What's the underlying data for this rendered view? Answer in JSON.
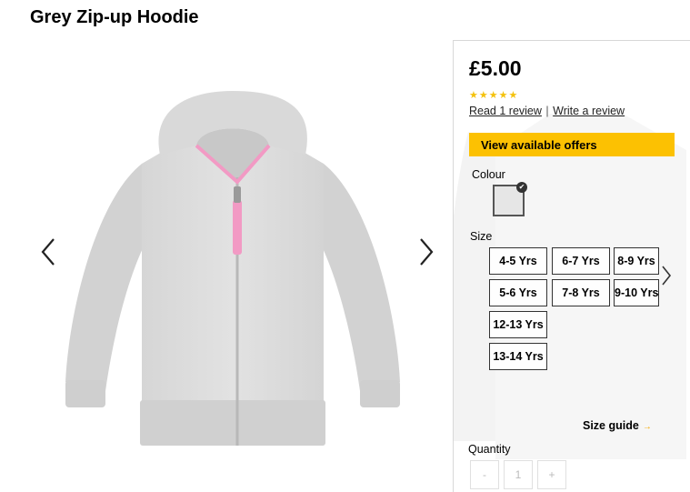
{
  "product": {
    "title": "Grey Zip-up Hoodie",
    "price": "£5.00",
    "stars": "★★★★★",
    "read_review": "Read 1 review",
    "separator": "|",
    "write_review": "Write a review",
    "offers_label": "View available offers",
    "colour_label": "Colour",
    "selected_colour": "#e6e6e6",
    "size_label": "Size",
    "sizes": [
      "4-5 Yrs",
      "6-7 Yrs",
      "8-9 Yrs",
      "5-6 Yrs",
      "7-8 Yrs",
      "9-10 Yrs",
      "12-13 Yrs",
      "13-14 Yrs"
    ],
    "size_guide": "Size guide",
    "size_guide_arrow": "→",
    "quantity_label": "Quantity",
    "qty_minus": "-",
    "qty_value": "1",
    "qty_plus": "+"
  },
  "colors": {
    "accent": "#fcc102",
    "star": "#f4c20d",
    "hoodie": "#dcdcdc",
    "zip_pull": "#f29ac4"
  },
  "icons": {
    "gallery_prev": "chevron-left-icon",
    "gallery_next": "chevron-right-icon",
    "sizes_next": "chevron-right-icon",
    "swatch_selected": "check-icon"
  }
}
